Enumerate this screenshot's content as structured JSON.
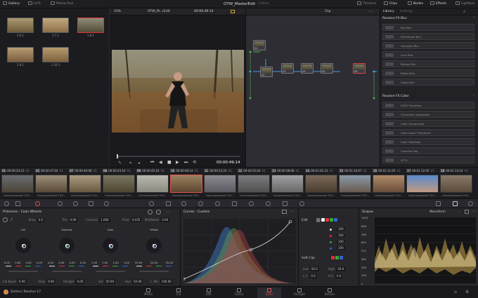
{
  "topbar": {
    "gallery": "Gallery",
    "luts": "LUTs",
    "media_pool": "Media Pool",
    "project_title": "OTW_MasterEdit",
    "edited": "Edited",
    "timeline": "Timeline",
    "clips": "Clips",
    "nodes": "Nodes",
    "effects": "Effects",
    "lightbox": "Lightbox"
  },
  "gallery": {
    "stills": [
      "1.6.1",
      "1.7.1",
      "1.8.1",
      "1.9.1",
      "1.10.1"
    ]
  },
  "viewer": {
    "zoom": "33%",
    "timeline_name": "OTW_M...rEdit",
    "timecode": "00:00:49:14",
    "transport_timecode": "00:00:49:14"
  },
  "nodes": {
    "mode": "Clip",
    "items": [
      "01",
      "02",
      "03",
      "04",
      "05",
      "06"
    ]
  },
  "library": {
    "tab_library": "Library",
    "tab_settings": "Settings",
    "section_blur": "Resolve FX Blur",
    "blur_items": [
      "Box Blur",
      "Directional Blur",
      "Gaussian Blur",
      "Lens Blur",
      "Mosaic Blur",
      "Radial Blur",
      "Zoom Blur"
    ],
    "section_color": "Resolve FX Color",
    "color_items": [
      "ACES Transform",
      "Chromatic Adaptation",
      "Color Compressor",
      "Color Space Transform",
      "Color Stabilizer",
      "Contrast Pop",
      "DCTL"
    ]
  },
  "clips": [
    {
      "num": "01",
      "tc": "00:00:23:23",
      "track": "V1",
      "name": "Uncompressed YUV..."
    },
    {
      "num": "02",
      "tc": "00:00:37:04",
      "track": "V1",
      "name": "Uncompressed YUV..."
    },
    {
      "num": "07",
      "tc": "00:00:40:06",
      "track": "V1",
      "name": "Uncompressed YUV..."
    },
    {
      "num": "08",
      "tc": "00:00:43:10",
      "track": "V1",
      "name": "Uncompressed YUV..."
    },
    {
      "num": "09",
      "tc": "00:00:45:24",
      "track": "V1",
      "name": "Uncompressed YUV..."
    },
    {
      "num": "10",
      "tc": "00:00:49:14",
      "track": "V1",
      "name": "Uncompressed YUV..."
    },
    {
      "num": "11",
      "tc": "00:00:53:24",
      "track": "V1",
      "name": "Uncompressed YUV..."
    },
    {
      "num": "12",
      "tc": "00:00:55:04",
      "track": "V1",
      "name": "Uncompressed YUV..."
    },
    {
      "num": "13",
      "tc": "00:00:58:08",
      "track": "V1",
      "name": "Uncompressed YUV..."
    },
    {
      "num": "14",
      "tc": "00:01:01:23",
      "track": "V1",
      "name": "Uncompressed YUV..."
    },
    {
      "num": "15",
      "tc": "00:01:10:07",
      "track": "V1",
      "name": "Uncompressed YUV..."
    },
    {
      "num": "16",
      "tc": "00:01:11:05",
      "track": "V1",
      "name": "Uncompressed YUV..."
    },
    {
      "num": "17",
      "tc": "00:01:12:05",
      "track": "V1",
      "name": "Uncompressed YUV..."
    },
    {
      "num": "18",
      "tc": "00:01:13:24",
      "track": "V1",
      "name": "Uncompressed YUV..."
    }
  ],
  "primaries": {
    "title": "Primaries - Color Wheels",
    "temp_label": "Temp",
    "temp_value": "0.0",
    "tint_label": "Tint",
    "tint_value": "0.00",
    "contrast_label": "Contrast",
    "contrast_value": "1.000",
    "pivot_label": "Pivot",
    "pivot_value": "0.435",
    "middetail_label": "Mid/Detail",
    "middetail_value": "0.00",
    "wheels": [
      {
        "name": "Lift",
        "values": [
          "0.00",
          "0.00",
          "0.00",
          "0.00"
        ]
      },
      {
        "name": "Gamma",
        "values": [
          "0.00",
          "0.00",
          "0.00",
          "0.00"
        ]
      },
      {
        "name": "Gain",
        "values": [
          "1.00",
          "1.00",
          "1.00",
          "1.00"
        ]
      },
      {
        "name": "Offset",
        "values": [
          "25.00",
          "25.00",
          "25.00",
          ""
        ]
      }
    ],
    "colboost_label": "Col Boost",
    "colboost_value": "0.00",
    "shad_label": "Shad",
    "shad_value": "0.00",
    "hilight_label": "Hi/Light",
    "hilight_value": "0.00",
    "sat_label": "Sat",
    "sat_value": "50.00",
    "hue_label": "Hue",
    "hue_value": "50.00",
    "lmix_label": "L. Mix",
    "lmix_value": "100.00"
  },
  "curves": {
    "title": "Curves - Custom"
  },
  "edit": {
    "title": "Edit",
    "values": [
      "100",
      "100",
      "100",
      "100"
    ],
    "softclip_title": "Soft Clip",
    "low_label": "Low",
    "low_value": "50.0",
    "high_label": "High",
    "high_value": "50.0",
    "ls_label": "L.S.",
    "ls_value": "0.0",
    "hs_label": "H.S.",
    "hs_value": "0.0"
  },
  "scopes": {
    "title": "Scopes",
    "mode": "Waveform",
    "ticks": [
      "1023",
      "896",
      "768",
      "640",
      "512",
      "384",
      "256",
      "128",
      "0"
    ]
  },
  "pages": [
    "Media",
    "Cut",
    "Edit",
    "Fusion",
    "Color",
    "Fairlight",
    "Deliver"
  ],
  "active_page": "Color",
  "app_name": "DaVinci Resolve 17",
  "colors": {
    "accent": "#e0544a",
    "node_link": "#3a9ee8",
    "selection": "#d33c3c"
  }
}
